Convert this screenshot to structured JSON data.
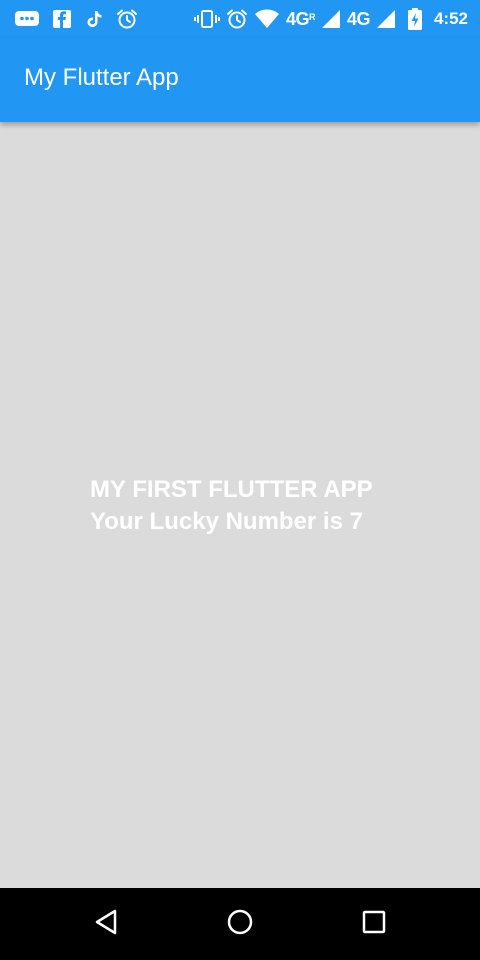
{
  "status_bar": {
    "left_icons": [
      "messaging-icon",
      "facebook-icon",
      "tiktok-icon",
      "alarm-icon"
    ],
    "right_icons": [
      "vibrate-icon",
      "alarm-icon",
      "wifi-icon",
      "signal-icon",
      "signal-icon",
      "battery-icon"
    ],
    "network_1": "4G",
    "network_1_sup": "R",
    "network_2": "4G",
    "time": "4:52"
  },
  "app_bar": {
    "title": "My Flutter App",
    "color": "#2196f3"
  },
  "main": {
    "line1": "MY FIRST FLUTTER APP",
    "line2": "Your Lucky Number is 7",
    "background": "#dbdbdb"
  },
  "nav_bar": {
    "buttons": [
      "back-icon",
      "home-icon",
      "recents-icon"
    ]
  }
}
